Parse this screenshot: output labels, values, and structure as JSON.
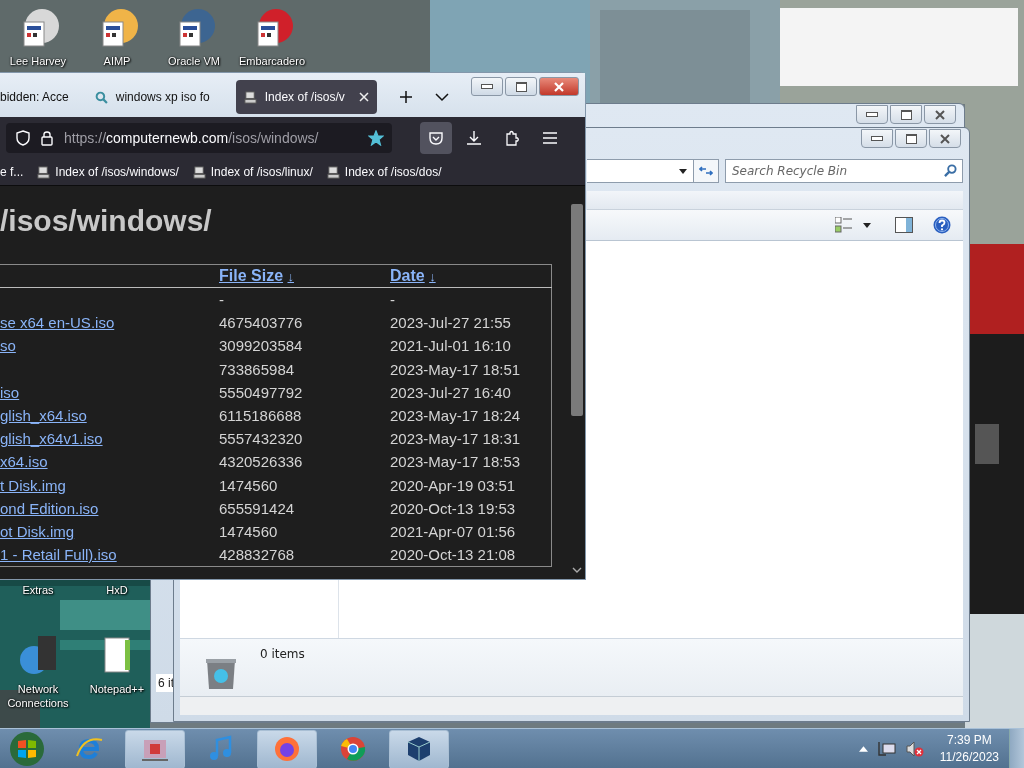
{
  "desktop_icons": [
    {
      "label": "Lee Harvey",
      "color": "#d8d8d8"
    },
    {
      "label": "AIMP",
      "color": "#f0b448"
    },
    {
      "label": "Oracle VM",
      "color": "#3d6591"
    },
    {
      "label": "Embarcadero",
      "color": "#d0202a"
    }
  ],
  "desktop_labels": [
    "Extras",
    "HxD"
  ],
  "desktop_icons_lower": [
    {
      "label": "Network Connections",
      "color": "#3a8fd8"
    },
    {
      "label": "Notepad++",
      "color": "#7cc043"
    }
  ],
  "explorer_back": {
    "status_text": "6 it"
  },
  "explorer_front": {
    "search": {
      "placeholder": "Search Recycle Bin"
    },
    "status_text": "0 items"
  },
  "browser": {
    "tabs": [
      {
        "title": "bidden: Acce",
        "kind": "page",
        "selected": false
      },
      {
        "title": "windows xp iso fo",
        "kind": "search",
        "selected": false
      },
      {
        "title": "Index of /isos/v",
        "kind": "page",
        "selected": true
      }
    ],
    "url": {
      "scheme": "https://",
      "host": "computernewb.com",
      "path": "/isos/windows/"
    },
    "bookmarked": true,
    "bookmarks": [
      {
        "label": "e f...",
        "kind": "text"
      },
      {
        "label": "Index of /isos/windows/",
        "kind": "page"
      },
      {
        "label": "Index of /isos/linux/",
        "kind": "page"
      },
      {
        "label": "Index of /isos/dos/",
        "kind": "page"
      }
    ],
    "heading": "/isos/windows/",
    "columns": [
      {
        "label": "File Size",
        "sort_arrow": "↓"
      },
      {
        "label": "Date",
        "sort_arrow": "↓"
      }
    ],
    "rows": [
      {
        "size": "-",
        "date": "-"
      },
      {
        "name": "se x64 en-US.iso",
        "size": "4675403776",
        "date": "2023-Jul-27 21:55"
      },
      {
        "name": "so",
        "size": "3099203584",
        "date": "2021-Jul-01 16:10"
      },
      {
        "size": "733865984",
        "date": "2023-May-17 18:51"
      },
      {
        "name": "iso",
        "size": "5550497792",
        "date": "2023-Jul-27 16:40"
      },
      {
        "name": "glish_x64.iso",
        "size": "6115186688",
        "date": "2023-May-17 18:24"
      },
      {
        "name": "glish_x64v1.iso",
        "size": "5557432320",
        "date": "2023-May-17 18:31"
      },
      {
        "name": "x64.iso",
        "size": "4320526336",
        "date": "2023-May-17 18:53"
      },
      {
        "name": "t Disk.img",
        "size": "1474560",
        "date": "2020-Apr-19 03:51"
      },
      {
        "name": "ond Edition.iso",
        "size": "655591424",
        "date": "2020-Oct-13 19:53"
      },
      {
        "name": "ot Disk.img",
        "size": "1474560",
        "date": "2021-Apr-07 01:56"
      },
      {
        "name": "1 - Retail Full).iso",
        "size": "428832768",
        "date": "2020-Oct-13 21:08"
      }
    ]
  },
  "taskbar": {
    "items": [
      {
        "open": false
      },
      {
        "open": true
      },
      {
        "open": false
      },
      {
        "open": true
      },
      {
        "open": false
      },
      {
        "open": true
      }
    ],
    "tray": {
      "muted": true,
      "time": "7:39 PM",
      "date": "11/26/2023"
    }
  }
}
